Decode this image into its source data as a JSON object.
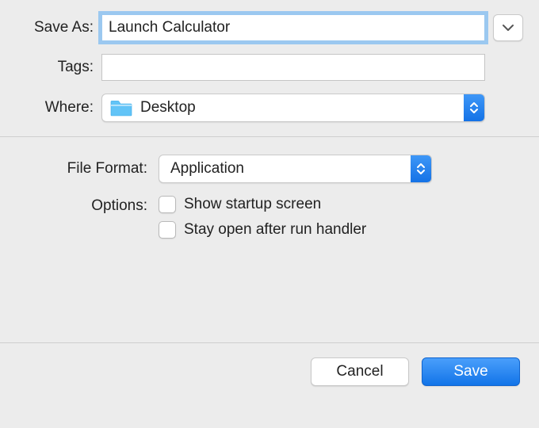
{
  "labels": {
    "save_as": "Save As:",
    "tags": "Tags:",
    "where": "Where:",
    "file_format": "File Format:",
    "options": "Options:"
  },
  "save_as": {
    "value": "Launch Calculator"
  },
  "tags": {
    "value": ""
  },
  "where": {
    "selected": "Desktop"
  },
  "file_format": {
    "selected": "Application"
  },
  "options": {
    "show_startup_label": "Show startup screen",
    "show_startup_checked": false,
    "stay_open_label": "Stay open after run handler",
    "stay_open_checked": false
  },
  "buttons": {
    "cancel": "Cancel",
    "save": "Save"
  },
  "colors": {
    "accent": "#1679ec",
    "focus_ring": "#9bc8f0",
    "panel_bg": "#ececec"
  }
}
